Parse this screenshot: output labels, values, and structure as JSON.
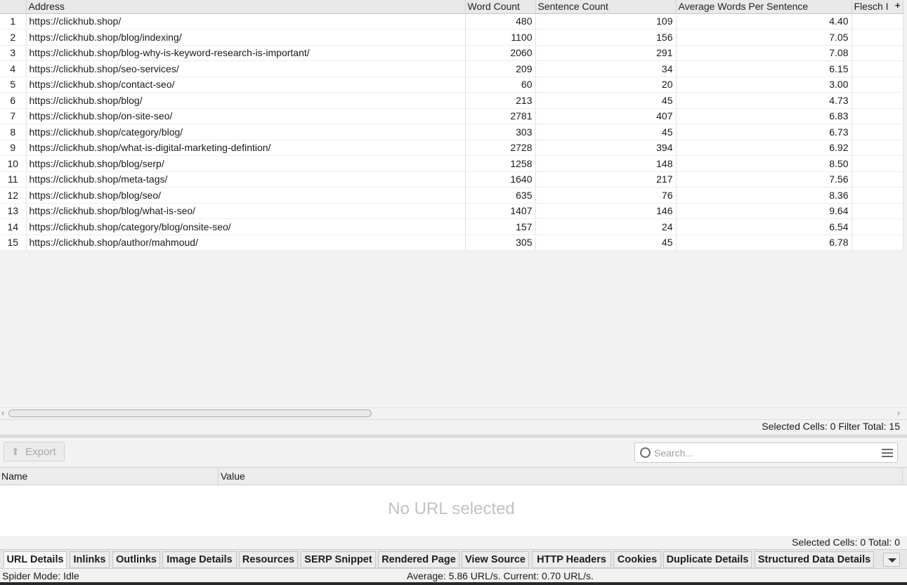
{
  "grid": {
    "columns": [
      "",
      "Address",
      "Word Count",
      "Sentence Count",
      "Average Words Per Sentence",
      "Flesch I"
    ],
    "rows": [
      {
        "idx": "1",
        "address": "https://clickhub.shop/",
        "word_count": "480",
        "sentence_count": "109",
        "avg_words": "4.40"
      },
      {
        "idx": "2",
        "address": "https://clickhub.shop/blog/indexing/",
        "word_count": "1100",
        "sentence_count": "156",
        "avg_words": "7.05"
      },
      {
        "idx": "3",
        "address": "https://clickhub.shop/blog-why-is-keyword-research-is-important/",
        "word_count": "2060",
        "sentence_count": "291",
        "avg_words": "7.08"
      },
      {
        "idx": "4",
        "address": "https://clickhub.shop/seo-services/",
        "word_count": "209",
        "sentence_count": "34",
        "avg_words": "6.15"
      },
      {
        "idx": "5",
        "address": "https://clickhub.shop/contact-seo/",
        "word_count": "60",
        "sentence_count": "20",
        "avg_words": "3.00"
      },
      {
        "idx": "6",
        "address": "https://clickhub.shop/blog/",
        "word_count": "213",
        "sentence_count": "45",
        "avg_words": "4.73"
      },
      {
        "idx": "7",
        "address": "https://clickhub.shop/on-site-seo/",
        "word_count": "2781",
        "sentence_count": "407",
        "avg_words": "6.83"
      },
      {
        "idx": "8",
        "address": "https://clickhub.shop/category/blog/",
        "word_count": "303",
        "sentence_count": "45",
        "avg_words": "6.73"
      },
      {
        "idx": "9",
        "address": "https://clickhub.shop/what-is-digital-marketing-defintion/",
        "word_count": "2728",
        "sentence_count": "394",
        "avg_words": "6.92"
      },
      {
        "idx": "10",
        "address": "https://clickhub.shop/blog/serp/",
        "word_count": "1258",
        "sentence_count": "148",
        "avg_words": "8.50"
      },
      {
        "idx": "11",
        "address": "https://clickhub.shop/meta-tags/",
        "word_count": "1640",
        "sentence_count": "217",
        "avg_words": "7.56"
      },
      {
        "idx": "12",
        "address": "https://clickhub.shop/blog/seo/",
        "word_count": "635",
        "sentence_count": "76",
        "avg_words": "8.36"
      },
      {
        "idx": "13",
        "address": "https://clickhub.shop/blog/what-is-seo/",
        "word_count": "1407",
        "sentence_count": "146",
        "avg_words": "9.64"
      },
      {
        "idx": "14",
        "address": "https://clickhub.shop/category/blog/onsite-seo/",
        "word_count": "157",
        "sentence_count": "24",
        "avg_words": "6.54"
      },
      {
        "idx": "15",
        "address": "https://clickhub.shop/author/mahmoud/",
        "word_count": "305",
        "sentence_count": "45",
        "avg_words": "6.78"
      }
    ],
    "add_column_icon": "plus-icon"
  },
  "status_top": "Selected Cells:  0  Filter Total:  15",
  "toolbar": {
    "export_label": "Export",
    "export_icon": "upload-icon",
    "search_placeholder": "Search...",
    "search_icon": "search-icon",
    "filter_icon": "sliders-icon"
  },
  "details": {
    "columns": [
      "Name",
      "Value"
    ],
    "empty_message": "No URL selected"
  },
  "status_bottom": "Selected Cells:  0  Total:  0",
  "tabs": [
    {
      "label": "URL Details",
      "active": true
    },
    {
      "label": "Inlinks",
      "active": false
    },
    {
      "label": "Outlinks",
      "active": false
    },
    {
      "label": "Image Details",
      "active": false
    },
    {
      "label": "Resources",
      "active": false
    },
    {
      "label": "SERP Snippet",
      "active": false
    },
    {
      "label": "Rendered Page",
      "active": false
    },
    {
      "label": "View Source",
      "active": false
    },
    {
      "label": "HTTP Headers",
      "active": false
    },
    {
      "label": "Cookies",
      "active": false
    },
    {
      "label": "Duplicate Details",
      "active": false
    },
    {
      "label": "Structured Data Details",
      "active": false
    }
  ],
  "footer": {
    "spider_mode": "Spider Mode: Idle",
    "speed": "Average: 5.86 URL/s. Current: 0.70 URL/s."
  }
}
